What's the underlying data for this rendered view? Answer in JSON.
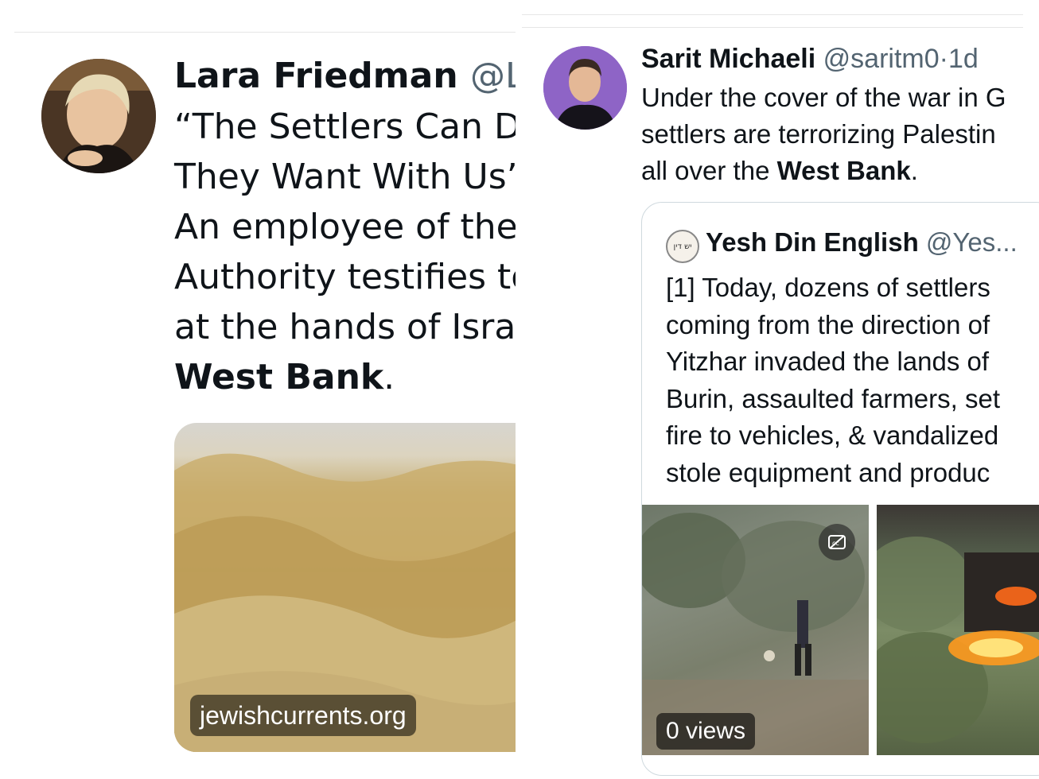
{
  "left_tweet": {
    "author_name": "Lara Friedman",
    "author_handle": "@La",
    "body_lines": [
      "“The Settlers Can D",
      "They Want With Us’",
      "An employee of the",
      "Authority testifies to",
      "at the hands of Israe"
    ],
    "body_bold_end": "West Bank",
    "body_end_punct": ".",
    "card_link": "jewishcurrents.org"
  },
  "right_tweet": {
    "author_name": "Sarit Michaeli",
    "author_handle": "@saritm0",
    "separator": "·",
    "timestamp": "1d",
    "body_lines": [
      "Under the cover of the war in G",
      "settlers are terrorizing Palestin"
    ],
    "body_last_prefix": "all over the ",
    "body_bold_end": "West Bank",
    "body_end_punct": ".",
    "quote": {
      "author_name": "Yesh Din English",
      "author_handle": "@Yes...",
      "avatar_text": "יש דין",
      "body_lines": [
        "[1] Today, dozens of settlers",
        "coming from the direction of",
        "Yitzhar invaded the lands of",
        "Burin, assaulted farmers, set",
        "fire to vehicles, & vandalized",
        "stole equipment and produc"
      ],
      "media_views": "0 views",
      "captions_icon": "closed-captions-off-icon"
    }
  }
}
